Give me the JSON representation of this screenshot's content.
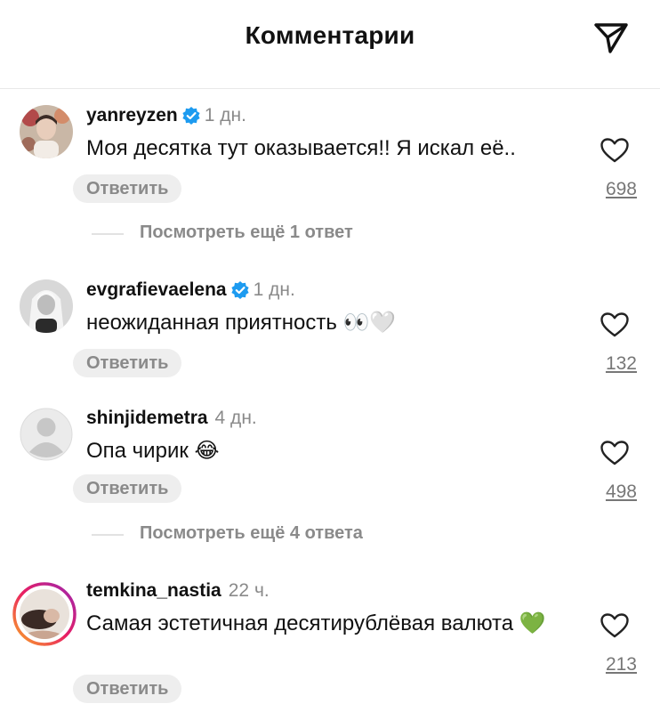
{
  "header": {
    "title": "Комментарии",
    "send_icon": "paper-plane-icon"
  },
  "comments": [
    {
      "username": "yanreyzen",
      "verified": true,
      "time": "1 дн.",
      "text": "Моя десятка тут оказывается!! Я искал её..",
      "reply_label": "Ответить",
      "likes": "698",
      "more_replies": "Посмотреть ещё 1 ответ"
    },
    {
      "username": "evgrafievaelena",
      "verified": true,
      "time": "1 дн.",
      "text": "неожиданная приятность 👀🤍",
      "reply_label": "Ответить",
      "likes": "132"
    },
    {
      "username": "shinjidemetra",
      "verified": false,
      "time": "4 дн.",
      "text": "Опа чирик 😂",
      "reply_label": "Ответить",
      "likes": "498",
      "more_replies": "Посмотреть ещё 4 ответа"
    },
    {
      "username": "temkina_nastia",
      "verified": false,
      "time": "22 ч.",
      "text": "Самая эстетичная десятирублёвая валюта 💚",
      "reply_label": "Ответить",
      "likes": "213",
      "has_story_ring": true
    }
  ],
  "colors": {
    "verified": "#1d9bf0",
    "secondary_text": "#8a8a8a",
    "reply_bg": "#eeeeee",
    "story_ring": [
      "#f9a825",
      "#e91e63",
      "#9c27b0"
    ]
  }
}
